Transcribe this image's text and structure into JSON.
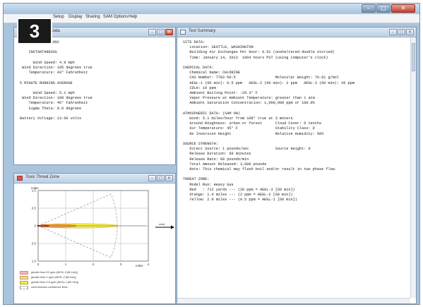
{
  "step_badge": "3",
  "menu": [
    "Setup",
    "Display",
    "Sharing",
    "SAM Options",
    "Help"
  ],
  "app_controls": {
    "minimize": "–",
    "maximize": "□",
    "close": "✕"
  },
  "site_window": {
    "title": "Data",
    "lines": [
      "d Station ID: 2002",
      "",
      "    INSTANTANEOUS",
      "",
      "      Wind Speed: 4.9 mph",
      " Wind Direction: 195 degrees true",
      "    Temperature: 43° Fahrenheit",
      "",
      "5 MINUTE RUNNING AVERAGE",
      "",
      "      Wind Speed: 5.1 mph",
      " Wind Direction: 108 degrees true",
      "    Temperature: 45° Fahrenheit",
      "    Sigma Theta: 0.0 degrees",
      "",
      "Battery Voltage: 13.60 volts"
    ]
  },
  "threat_window": {
    "title": "Toxic Threat Zone",
    "y_unit": "miles",
    "x_unit": "miles",
    "y_ticks": [
      "1.0",
      "0.5",
      "0",
      "0.5",
      "1.0"
    ],
    "x_ticks": [
      "0",
      "1",
      "2",
      "3",
      "4"
    ],
    "wind_label": "wind",
    "legend": [
      {
        "swatch": "#f2b8b8",
        "border": "#c98a8a",
        "label": "greater than 20 ppm (AEGL-3 [60 min])"
      },
      {
        "swatch": "#f6d3a4",
        "border": "#c79b5c",
        "label": "greater than 2 ppm (AEGL-2 [60 min])"
      },
      {
        "swatch": "#f4ec4a",
        "border": "#b4a70d",
        "label": "greater than 0.5 ppm (AEGL-1 [60 min])"
      },
      {
        "swatch": "#ffffff",
        "border": "#999999",
        "label": "wind direction confidence lines"
      }
    ],
    "chart_data": {
      "type": "area",
      "x_range": [
        0,
        4
      ],
      "y_range": [
        -1,
        1
      ],
      "xlabel": "miles",
      "ylabel": "miles",
      "zones": [
        {
          "name": "Red",
          "threshold": "20 ppm",
          "length_miles": 0.41
        },
        {
          "name": "Orange",
          "threshold": "2 ppm",
          "length_miles": 1.4
        },
        {
          "name": "Yellow",
          "threshold": "0.5 ppm",
          "length_miles": 2.9
        }
      ],
      "confidence_extent_miles": 2.9
    }
  },
  "summary_window": {
    "title": "Text Summary",
    "lines": [
      "SITE DATA:",
      "   Location: SEATTLE, WASHINGTON",
      "   Building Air Exchanges Per Hour: 0.52 (unsheltered double storied)",
      "   Time: January 14, 2013  1004 hours PST (using computer's clock)",
      "",
      "CHEMICAL DATA:",
      "   Chemical Name: CHLORINE",
      "   CAS Number: 7782-50-5                  Molecular Weight: 70.91 g/mol",
      "   AEGL-1 (60 min): 0.5 ppm   AEGL-2 (60 min): 2 ppm   AEGL-3 (60 min): 20 ppm",
      "   IDLH: 10 ppm",
      "   Ambient Boiling Point: -29.3° F",
      "   Vapor Pressure at Ambient Temperature: greater than 1 atm",
      "   Ambient Saturation Concentration: 1,000,000 ppm or 100.0%",
      "",
      "ATMOSPHERIC DATA: (SAM ON)",
      "   Wind: 5.1 miles/hour from 108° true at 3 meters",
      "   Ground Roughness: urban or forest      Cloud Cover: 0 tenths",
      "   Air Temperature: 45° F                 Stability Class: D",
      "   No Inversion Height                    Relative Humidity: 50%",
      "",
      "SOURCE STRENGTH:",
      "   Direct Source: 1 pounds/sec            Source Height: 0",
      "   Release Duration: 60 minutes",
      "   Release Rate: 60 pounds/min",
      "   Total Amount Released: 3,600 pounds",
      "   Note: This chemical may flash boil and/or result in two phase flow.",
      "",
      "THREAT ZONE:",
      "   Model Run: Heavy Gas",
      "   Red   : 712 yards --- (20 ppm = AEGL-3 [60 min])",
      "   Orange: 1.4 miles --- (2 ppm = AEGL-2 [60 min])",
      "   Yellow: 2.9 miles --- (0.5 ppm = AEGL-1 [60 min])"
    ]
  }
}
